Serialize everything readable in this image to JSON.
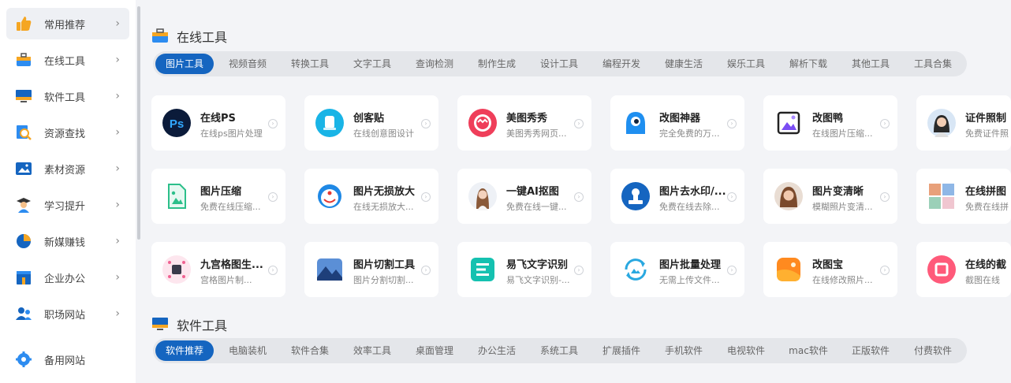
{
  "sidebar": {
    "items": [
      {
        "label": "常用推荐",
        "icon": "thumbs-up-icon",
        "arrow": "›"
      },
      {
        "label": "在线工具",
        "icon": "toolbox-icon",
        "arrow": "›"
      },
      {
        "label": "软件工具",
        "icon": "monitor-icon",
        "arrow": "›"
      },
      {
        "label": "资源查找",
        "icon": "search-doc-icon",
        "arrow": "›"
      },
      {
        "label": "素材资源",
        "icon": "image-icon",
        "arrow": "›"
      },
      {
        "label": "学习提升",
        "icon": "student-icon",
        "arrow": "›"
      },
      {
        "label": "新媒赚钱",
        "icon": "pie-chart-icon",
        "arrow": "›"
      },
      {
        "label": "企业办公",
        "icon": "office-icon",
        "arrow": "›"
      },
      {
        "label": "职场网站",
        "icon": "users-icon",
        "arrow": "›"
      },
      {
        "label": "备用网站",
        "icon": "gear-icon"
      }
    ]
  },
  "online": {
    "title": "在线工具",
    "tabs": [
      "图片工具",
      "视频音频",
      "转换工具",
      "文字工具",
      "查询检测",
      "制作生成",
      "设计工具",
      "编程开发",
      "健康生活",
      "娱乐工具",
      "解析下载",
      "其他工具",
      "工具合集"
    ],
    "active_tab": 0,
    "cards": [
      {
        "title": "在线PS",
        "desc": "在线ps图片处理"
      },
      {
        "title": "创客贴",
        "desc": "在线创意图设计"
      },
      {
        "title": "美图秀秀",
        "desc": "美图秀秀网页..."
      },
      {
        "title": "改图神器",
        "desc": "完全免费的万..."
      },
      {
        "title": "改图鸭",
        "desc": "在线图片压缩..."
      },
      {
        "title": "证件照制",
        "desc": "免费证件照"
      },
      {
        "title": "图片压缩",
        "desc": "免费在线压缩..."
      },
      {
        "title": "图片无损放大",
        "desc": "在线无损放大..."
      },
      {
        "title": "一键AI抠图",
        "desc": "免费在线一键..."
      },
      {
        "title": "图片去水印/...",
        "desc": "免费在线去除..."
      },
      {
        "title": "图片变清晰",
        "desc": "模糊照片变清..."
      },
      {
        "title": "在线拼图",
        "desc": "免费在线拼"
      },
      {
        "title": "九宫格图生...",
        "desc": "宫格图片制..."
      },
      {
        "title": "图片切割工具",
        "desc": "图片分割切割..."
      },
      {
        "title": "易飞文字识别",
        "desc": "易飞文字识别-..."
      },
      {
        "title": "图片批量处理",
        "desc": "无需上传文件..."
      },
      {
        "title": "改图宝",
        "desc": "在线修改照片..."
      },
      {
        "title": "在线的截",
        "desc": "截图在线"
      }
    ]
  },
  "software": {
    "title": "软件工具",
    "tabs": [
      "软件推荐",
      "电脑装机",
      "软件合集",
      "效率工具",
      "桌面管理",
      "办公生活",
      "系统工具",
      "扩展插件",
      "手机软件",
      "电视软件",
      "mac软件",
      "正版软件",
      "付费软件"
    ],
    "active_tab": 0
  },
  "colors": {
    "accent": "#1565c0",
    "tab_bg": "#e4e6ea",
    "page_bg": "#f3f4f7"
  }
}
